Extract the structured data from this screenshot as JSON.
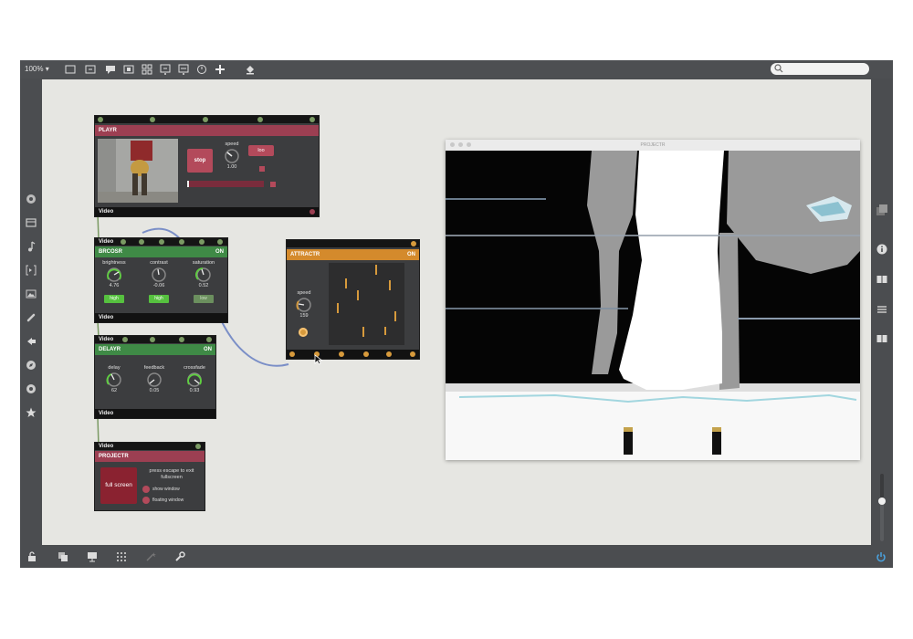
{
  "toolbar": {
    "zoom_label": "100%",
    "icons": [
      "new-patch-icon",
      "save-icon",
      "comment-icon",
      "module-icon",
      "group-icon",
      "import-icon",
      "export-icon",
      "history-icon",
      "add-icon",
      "bucket-icon"
    ],
    "search_placeholder": ""
  },
  "left_sidebar": {
    "icons": [
      "gear-icon",
      "film-icon",
      "music-note-icon",
      "bracket-icon",
      "image-icon",
      "link-icon",
      "arrow-left-icon",
      "compass-icon",
      "circle-icon",
      "star-icon"
    ]
  },
  "right_sidebar": {
    "icons": [
      "library-icon",
      "info-icon",
      "book-icon",
      "list-icon",
      "card-icon"
    ],
    "volume_level": 0.6
  },
  "bottom_bar": {
    "icons": [
      "lock-icon",
      "layers-icon",
      "presentation-icon",
      "grid-icon",
      "magic-icon",
      "wrench-icon"
    ],
    "power_icon": "power-icon"
  },
  "modules": {
    "player": {
      "title": "PLAYR",
      "stop_label": "stop",
      "speed_label": "speed",
      "speed_value": "1.00",
      "loop_label": "loo",
      "progress": 0.02,
      "footer": "Video"
    },
    "brightness_module": {
      "top_label": "Video",
      "title": "BRCOSR",
      "on_label": "ON",
      "knobs": [
        {
          "label": "brightness",
          "value": "4.76"
        },
        {
          "label": "contrast",
          "value": "-0.06"
        },
        {
          "label": "saturation",
          "value": "0.52"
        }
      ],
      "buttons": [
        "high",
        "high",
        "low"
      ],
      "footer": "Video"
    },
    "delay_module": {
      "top_label": "Video",
      "title": "DELAYR",
      "on_label": "ON",
      "knobs": [
        {
          "label": "delay",
          "value": "62"
        },
        {
          "label": "feedback",
          "value": "0.05"
        },
        {
          "label": "crossfade",
          "value": "0.93"
        }
      ],
      "footer": "Video"
    },
    "attractor": {
      "title": "ATTRACTR",
      "on_label": "ON",
      "speed_label": "speed",
      "speed_value": "159"
    },
    "projector": {
      "top_label": "Video",
      "title": "PROJECTR",
      "fullscreen_label": "full screen",
      "escape_text": "press escape to exit fullscreen",
      "options": [
        "show window",
        "floating window"
      ]
    }
  },
  "output_window": {
    "title": "PROJECTR"
  },
  "colors": {
    "accent_red": "#b34a5b",
    "accent_green": "#56c13f",
    "accent_orange": "#d79a3c",
    "cable_blue": "#7b8fc7",
    "canvas": "#e6e6e2"
  }
}
